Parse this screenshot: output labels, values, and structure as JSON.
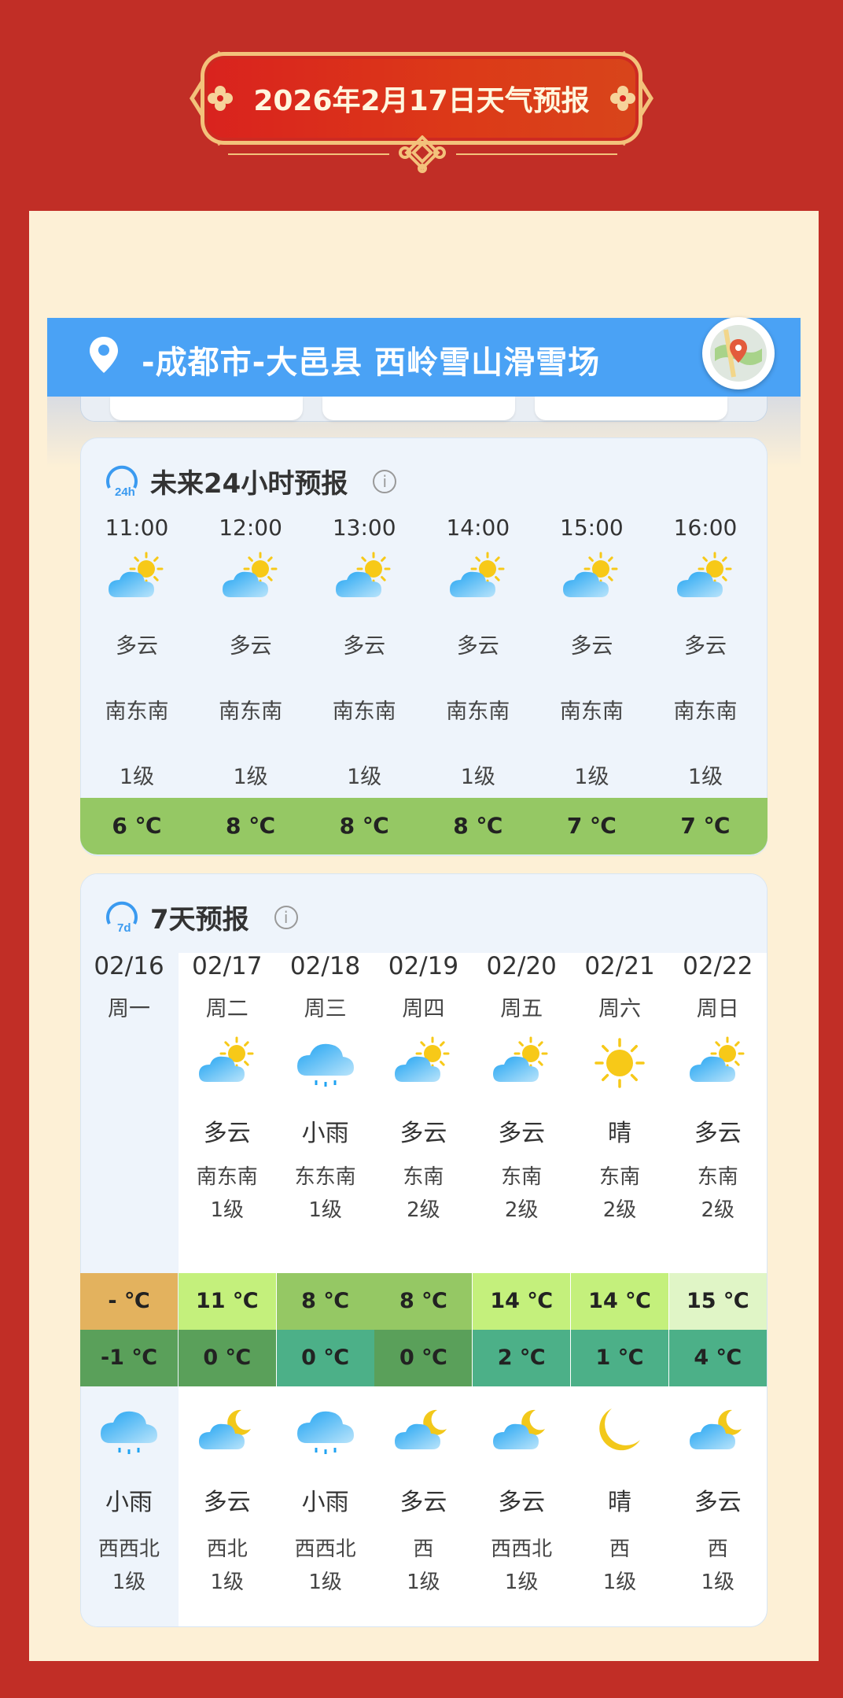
{
  "header": {
    "title": "2026年2月17日天气预报"
  },
  "location": {
    "text": "-成都市-大邑县 西岭雪山滑雪场"
  },
  "hourly": {
    "title": "未来24小时预报",
    "badge": "24h",
    "items": [
      {
        "time": "11:00",
        "cond": "多云",
        "wind_dir": "南东南",
        "wind_lvl": "1级",
        "temp": "6 ℃"
      },
      {
        "time": "12:00",
        "cond": "多云",
        "wind_dir": "南东南",
        "wind_lvl": "1级",
        "temp": "8 ℃"
      },
      {
        "time": "13:00",
        "cond": "多云",
        "wind_dir": "南东南",
        "wind_lvl": "1级",
        "temp": "8 ℃"
      },
      {
        "time": "14:00",
        "cond": "多云",
        "wind_dir": "南东南",
        "wind_lvl": "1级",
        "temp": "8 ℃"
      },
      {
        "time": "15:00",
        "cond": "多云",
        "wind_dir": "南东南",
        "wind_lvl": "1级",
        "temp": "7 ℃"
      },
      {
        "time": "16:00",
        "cond": "多云",
        "wind_dir": "南东南",
        "wind_lvl": "1级",
        "temp": "7 ℃"
      }
    ]
  },
  "weekly": {
    "title": "7天预报",
    "badge": "7d",
    "days": [
      {
        "date": "02/16",
        "week": "周一",
        "day_icon": "",
        "day_cond": "",
        "day_wind": "",
        "day_lvl": "",
        "high": "- ℃",
        "high_color": "#e3b25e",
        "low": "-1 ℃",
        "low_color": "#5aa05a",
        "night_icon": "rain-cloud-icon",
        "night_cond": "小雨",
        "night_wind": "西西北",
        "night_lvl": "1级"
      },
      {
        "date": "02/17",
        "week": "周二",
        "day_icon": "partly-cloudy-icon",
        "day_cond": "多云",
        "day_wind": "南东南",
        "day_lvl": "1级",
        "high": "11 ℃",
        "high_color": "#c4f07c",
        "low": "0 ℃",
        "low_color": "#5aa05a",
        "night_icon": "moon-cloud-icon",
        "night_cond": "多云",
        "night_wind": "西北",
        "night_lvl": "1级"
      },
      {
        "date": "02/18",
        "week": "周三",
        "day_icon": "rain-cloud-icon",
        "day_cond": "小雨",
        "day_wind": "东东南",
        "day_lvl": "1级",
        "high": "8 ℃",
        "high_color": "#95c864",
        "low": "0 ℃",
        "low_color": "#4cb088",
        "night_icon": "rain-cloud-icon",
        "night_cond": "小雨",
        "night_wind": "西西北",
        "night_lvl": "1级"
      },
      {
        "date": "02/19",
        "week": "周四",
        "day_icon": "partly-cloudy-icon",
        "day_cond": "多云",
        "day_wind": "东南",
        "day_lvl": "2级",
        "high": "8 ℃",
        "high_color": "#95c864",
        "low": "0 ℃",
        "low_color": "#5aa05a",
        "night_icon": "moon-cloud-icon",
        "night_cond": "多云",
        "night_wind": "西",
        "night_lvl": "1级"
      },
      {
        "date": "02/20",
        "week": "周五",
        "day_icon": "partly-cloudy-icon",
        "day_cond": "多云",
        "day_wind": "东南",
        "day_lvl": "2级",
        "high": "14 ℃",
        "high_color": "#c4f07c",
        "low": "2 ℃",
        "low_color": "#4cb088",
        "night_icon": "moon-cloud-icon",
        "night_cond": "多云",
        "night_wind": "西西北",
        "night_lvl": "1级"
      },
      {
        "date": "02/21",
        "week": "周六",
        "day_icon": "sun-icon",
        "day_cond": "晴",
        "day_wind": "东南",
        "day_lvl": "2级",
        "high": "14 ℃",
        "high_color": "#c4f07c",
        "low": "1 ℃",
        "low_color": "#4cb088",
        "night_icon": "moon-icon",
        "night_cond": "晴",
        "night_wind": "西",
        "night_lvl": "1级"
      },
      {
        "date": "02/22",
        "week": "周日",
        "day_icon": "partly-cloudy-icon",
        "day_cond": "多云",
        "day_wind": "东南",
        "day_lvl": "2级",
        "high": "15 ℃",
        "high_color": "#e0f5c6",
        "low": "4 ℃",
        "low_color": "#4cb088",
        "night_icon": "moon-cloud-icon",
        "night_cond": "多云",
        "night_wind": "西",
        "night_lvl": "1级"
      }
    ]
  },
  "colors": {
    "page_bg": "#c12e26",
    "panel_bg": "#fdf0d6",
    "loc_bar": "#4aa2f5",
    "hourly_temp_row": "#95c864"
  }
}
